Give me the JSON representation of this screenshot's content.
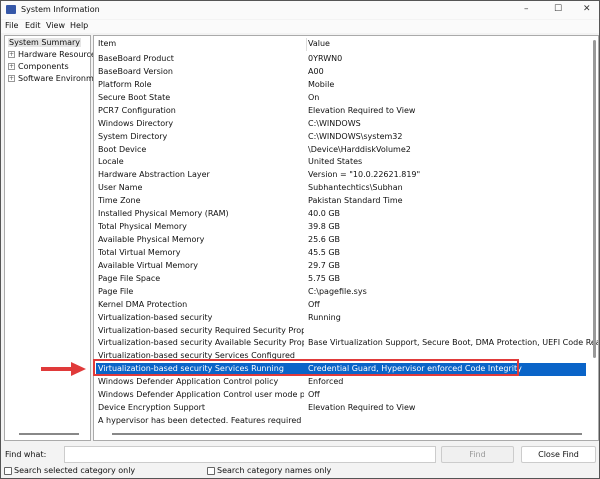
{
  "window": {
    "title": "System Information",
    "controls": {
      "minimize": "–",
      "maximize": "☐",
      "close": "✕"
    }
  },
  "menu": [
    "File",
    "Edit",
    "View",
    "Help"
  ],
  "tree": {
    "root": "System Summary",
    "children": [
      "Hardware Resources",
      "Components",
      "Software Environment"
    ],
    "expand_glyph": "+"
  },
  "table": {
    "headers": [
      "Item",
      "Value"
    ],
    "selected_index": 24,
    "rows": [
      [
        "BaseBoard Product",
        "0YRWN0"
      ],
      [
        "BaseBoard Version",
        "A00"
      ],
      [
        "Platform Role",
        "Mobile"
      ],
      [
        "Secure Boot State",
        "On"
      ],
      [
        "PCR7 Configuration",
        "Elevation Required to View"
      ],
      [
        "Windows Directory",
        "C:\\WINDOWS"
      ],
      [
        "System Directory",
        "C:\\WINDOWS\\system32"
      ],
      [
        "Boot Device",
        "\\Device\\HarddiskVolume2"
      ],
      [
        "Locale",
        "United States"
      ],
      [
        "Hardware Abstraction Layer",
        "Version = \"10.0.22621.819\""
      ],
      [
        "User Name",
        "Subhantechtics\\Subhan"
      ],
      [
        "Time Zone",
        "Pakistan Standard Time"
      ],
      [
        "Installed Physical Memory (RAM)",
        "40.0 GB"
      ],
      [
        "Total Physical Memory",
        "39.8 GB"
      ],
      [
        "Available Physical Memory",
        "25.6 GB"
      ],
      [
        "Total Virtual Memory",
        "45.5 GB"
      ],
      [
        "Available Virtual Memory",
        "29.7 GB"
      ],
      [
        "Page File Space",
        "5.75 GB"
      ],
      [
        "Page File",
        "C:\\pagefile.sys"
      ],
      [
        "Kernel DMA Protection",
        "Off"
      ],
      [
        "Virtualization-based security",
        "Running"
      ],
      [
        "Virtualization-based security Required Security Properties",
        ""
      ],
      [
        "Virtualization-based security Available Security Properties",
        "Base Virtualization Support, Secure Boot, DMA Protection, UEFI Code Readonly"
      ],
      [
        "Virtualization-based security Services Configured",
        ""
      ],
      [
        "Virtualization-based security Services Running",
        "Credential Guard, Hypervisor enforced Code Integrity"
      ],
      [
        "Windows Defender Application Control policy",
        "Enforced"
      ],
      [
        "Windows Defender Application Control user mode policy",
        "Off"
      ],
      [
        "Device Encryption Support",
        "Elevation Required to View"
      ],
      [
        "A hypervisor has been detected. Features required for ...",
        ""
      ]
    ]
  },
  "find": {
    "label": "Find what:",
    "value": "",
    "find_button": "Find",
    "close_button": "Close Find",
    "search_selected": "Search selected category only",
    "search_names": "Search category names only"
  },
  "colors": {
    "selection": "#0a64c8",
    "annotation": "#e03a3a"
  }
}
